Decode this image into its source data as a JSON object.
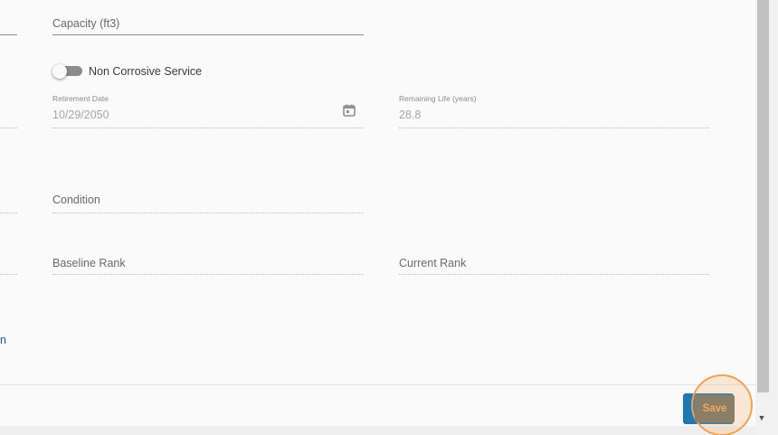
{
  "form": {
    "capacity": {
      "label": "Capacity (ft3)"
    },
    "non_corrosive": {
      "label": "Non Corrosive Service",
      "checked": false
    },
    "retirement_date": {
      "label": "Retirement Date",
      "value": "10/29/2050"
    },
    "remaining_life": {
      "label": "Remaining Life (years)",
      "value": "28.8"
    },
    "condition": {
      "label": "Condition"
    },
    "baseline_rank": {
      "label": "Baseline Rank"
    },
    "current_rank": {
      "label": "Current Rank"
    },
    "left_edge_text": "n"
  },
  "footer": {
    "save_label": "Save"
  },
  "icons": {
    "calendar": "calendar-icon",
    "scroll_down": "scroll-down-arrow-icon"
  },
  "colors": {
    "primary": "#1f77b4",
    "highlight": "#f0a050",
    "link": "#1f5e8a"
  }
}
